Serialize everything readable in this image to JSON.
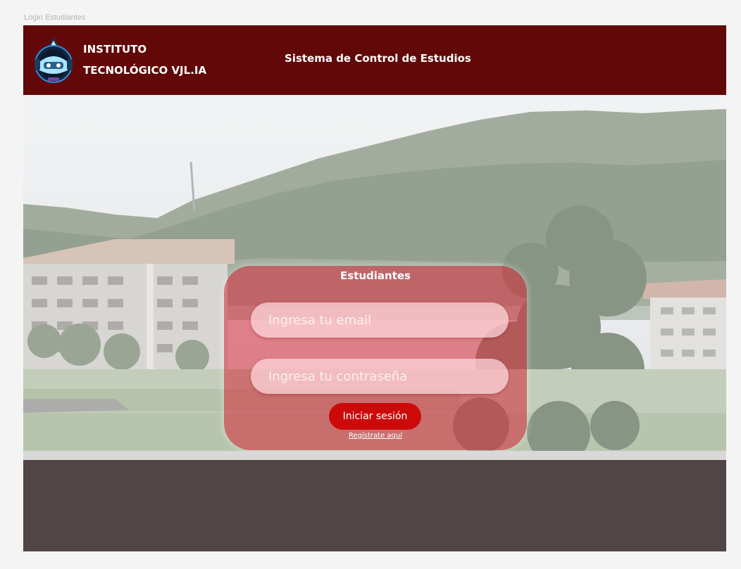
{
  "frame": {
    "label": "Login Estudiantes"
  },
  "header": {
    "logo_icon": "vr-robot-logo-icon",
    "brand_line_1": "INSTITUTO",
    "brand_line_2": "TECNOLÓGICO VJL.IA",
    "system_title": "Sistema de Control de Estudios",
    "background_color": "#620808"
  },
  "hero": {
    "image": "campus-photo"
  },
  "login": {
    "title": "Estudiantes",
    "email_placeholder": "Ingresa tu email",
    "password_placeholder": "Ingresa tu contraseña",
    "submit_label": "Iniciar sesión",
    "register_label": "Regístrate aquí",
    "card_color": "#d62838",
    "button_color": "#cc0a0a"
  },
  "footer": {
    "background_color": "#514545"
  }
}
